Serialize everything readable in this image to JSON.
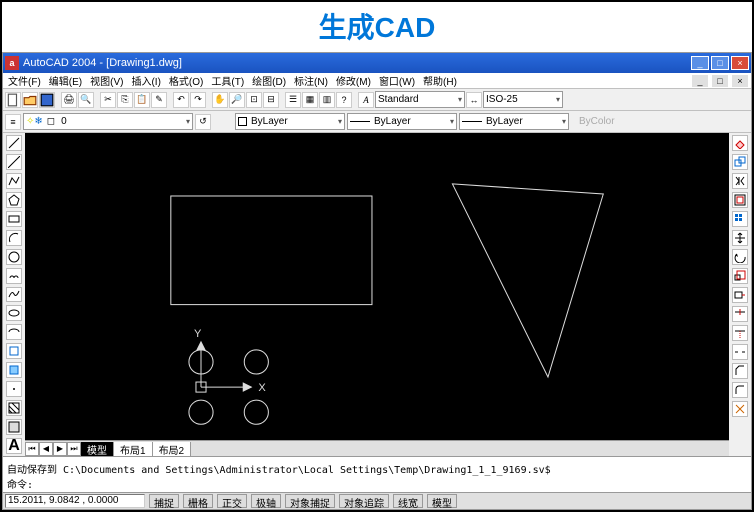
{
  "banner": "生成CAD",
  "titlebar": {
    "icon": "a",
    "text": "AutoCAD 2004 - [Drawing1.dwg]"
  },
  "winbtns": {
    "min": "_",
    "max": "□",
    "close": "×"
  },
  "menu": [
    "文件(F)",
    "编辑(E)",
    "视图(V)",
    "插入(I)",
    "格式(O)",
    "工具(T)",
    "绘图(D)",
    "标注(N)",
    "修改(M)",
    "窗口(W)",
    "帮助(H)"
  ],
  "combo": {
    "standard": "Standard",
    "iso": "ISO-25"
  },
  "layer": {
    "current": "0",
    "bylayer1": "ByLayer",
    "bylayer2": "ByLayer",
    "bylayer3": "ByLayer",
    "bycolor": "ByColor"
  },
  "tabs": {
    "model": "模型",
    "layout1": "布局1",
    "layout2": "布局2"
  },
  "cmd": {
    "line1": "自动保存到 C:\\Documents and Settings\\Administrator\\Local Settings\\Temp\\Drawing1_1_1_9169.sv$",
    "line2": "命令:"
  },
  "status": {
    "coord": "15.2011, 9.0842 , 0.0000",
    "btns": [
      "捕捉",
      "栅格",
      "正交",
      "极轴",
      "对象捕捉",
      "对象追踪",
      "线宽",
      "模型"
    ]
  },
  "ucs": {
    "x": "X",
    "y": "Y"
  }
}
